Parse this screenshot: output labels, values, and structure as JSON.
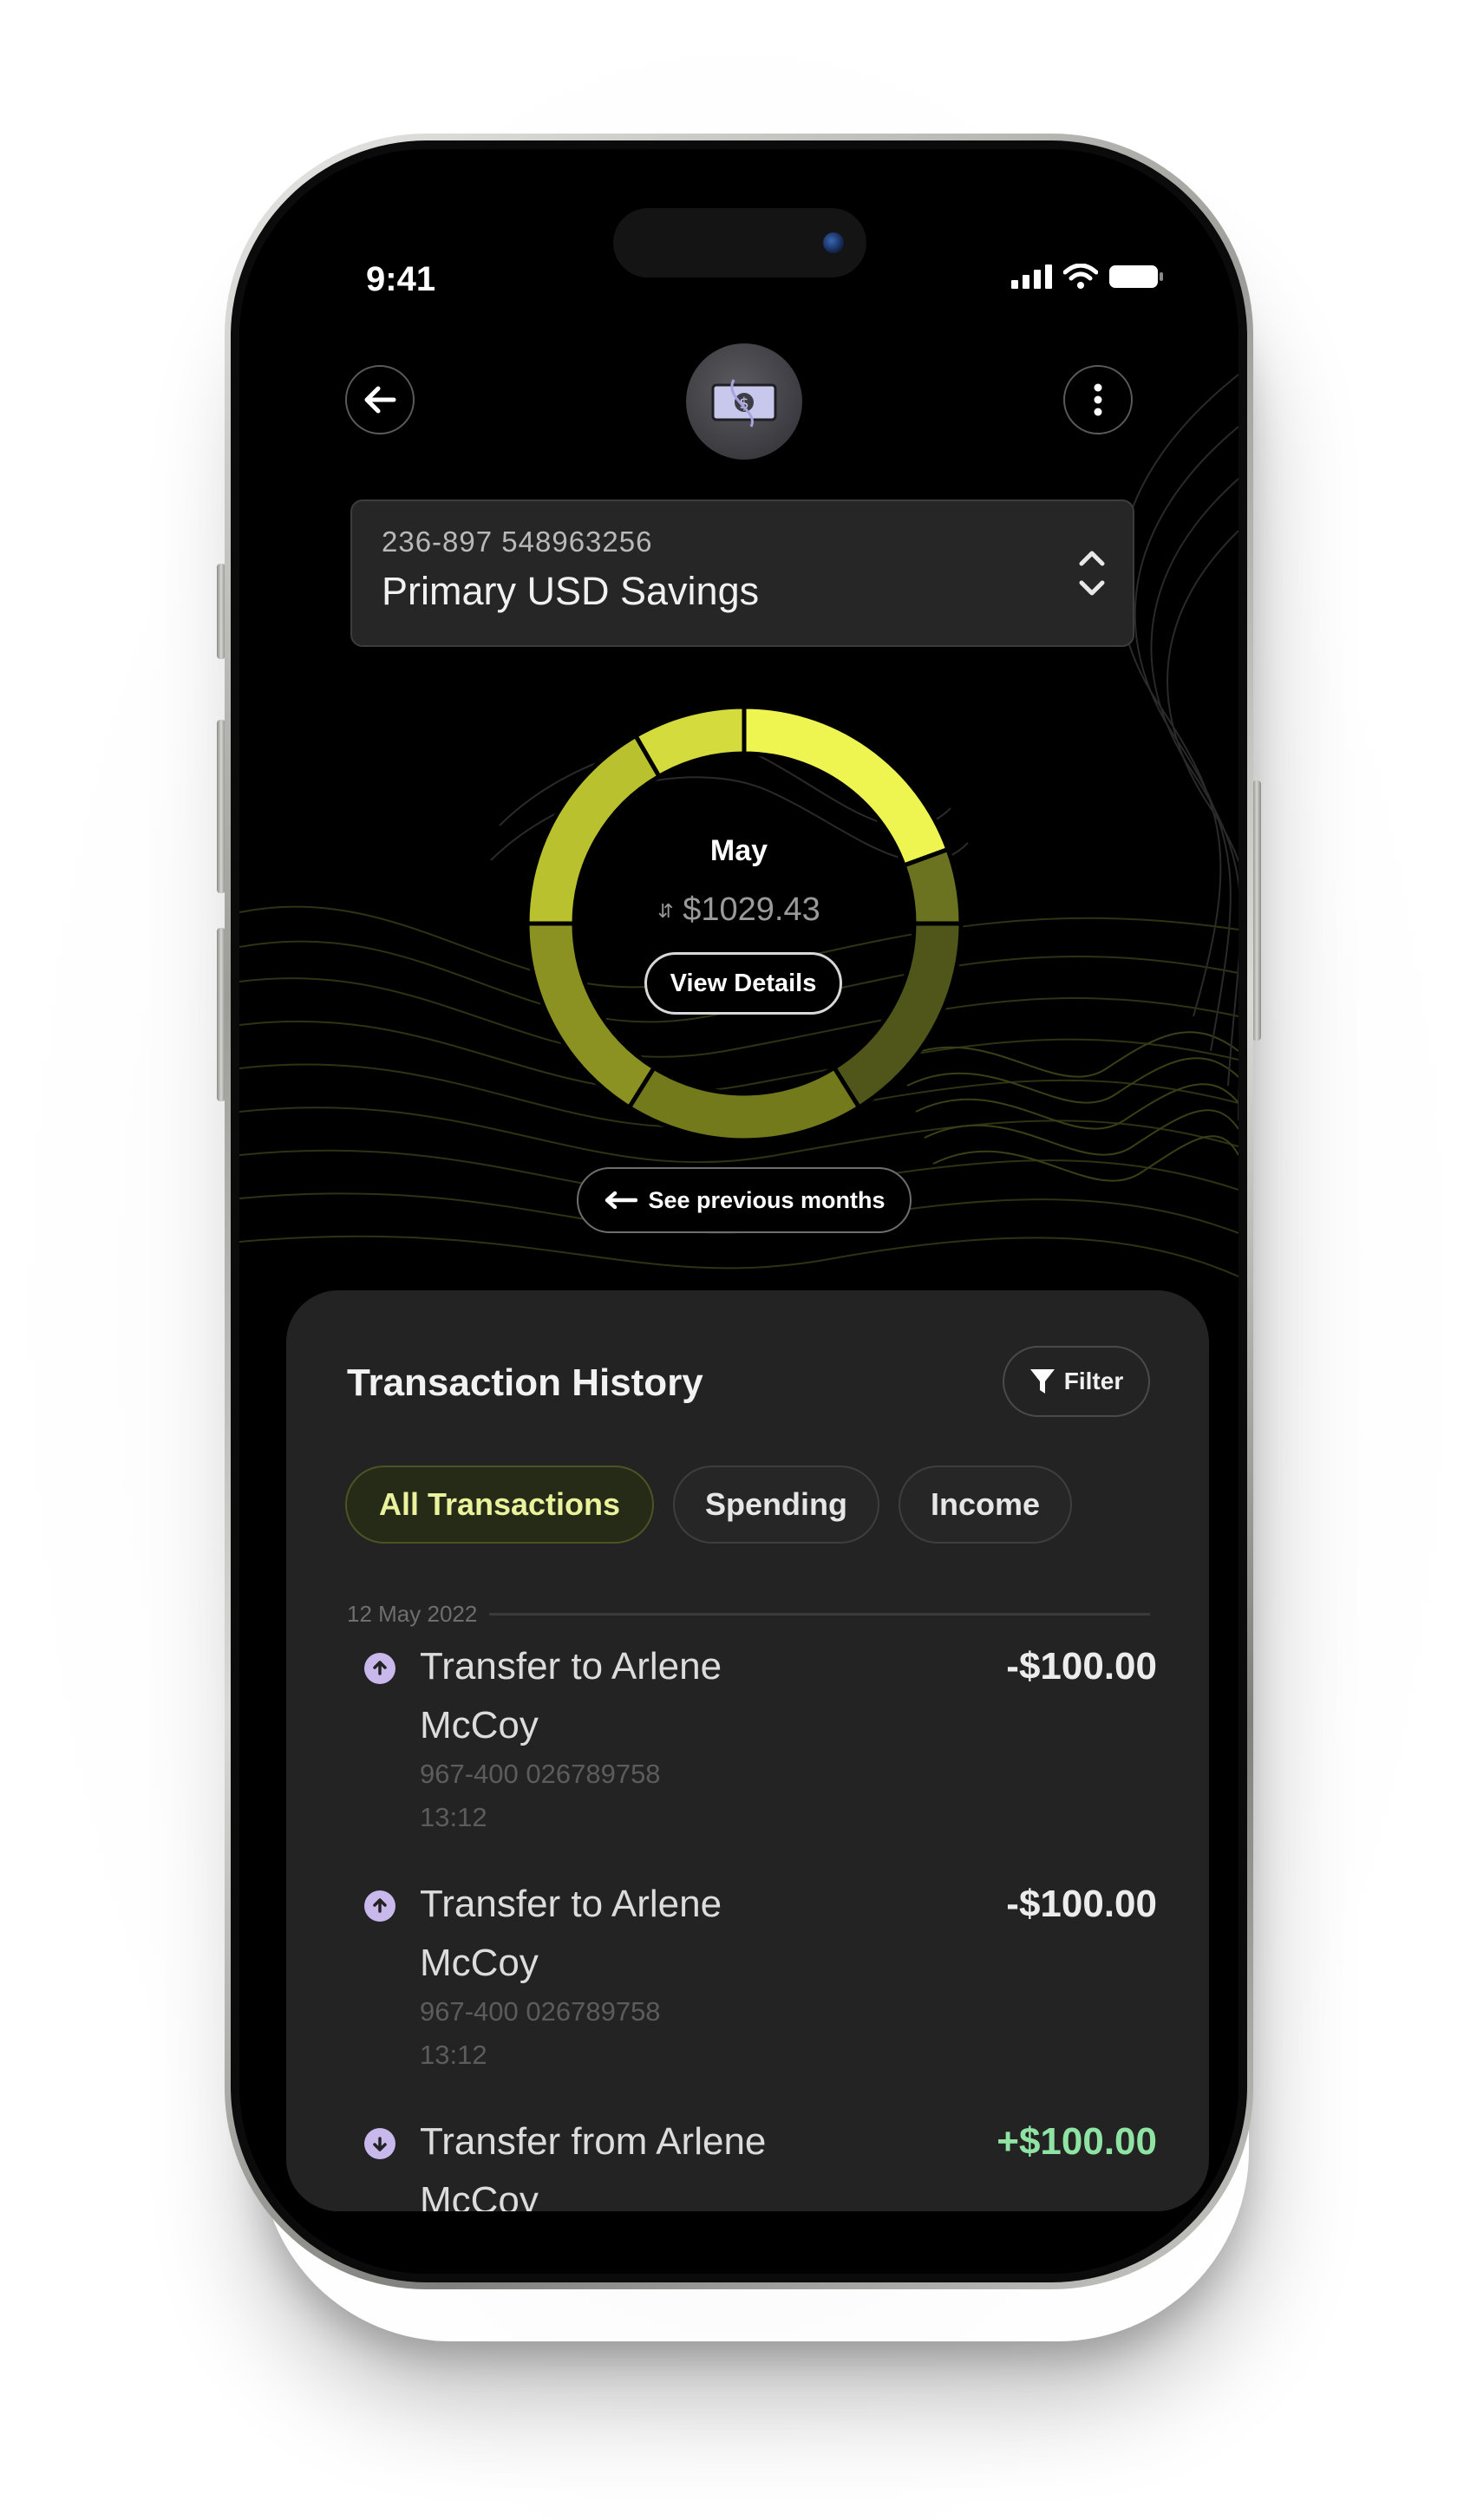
{
  "status_bar": {
    "time": "9:41"
  },
  "header": {
    "back_icon": "arrow-left-icon",
    "avatar_icon": "money-bill-icon",
    "more_icon": "vertical-dots-icon"
  },
  "account": {
    "number": "236-897 548963256",
    "name": "Primary USD Savings",
    "selector_icon": "chevron-up-down-icon"
  },
  "summary": {
    "month": "May",
    "amount": "$1029.43",
    "view_details_label": "View Details",
    "previous_months_label": "See previous months",
    "segment_colors": [
      "#eef551",
      "#d4db3c",
      "#b9c22e",
      "#8b9222",
      "#727a1b",
      "#50551a",
      "#6b7320"
    ]
  },
  "history": {
    "title": "Transaction History",
    "filter_label": "Filter",
    "tabs": [
      {
        "label": "All Transactions",
        "active": true
      },
      {
        "label": "Spending",
        "active": false
      },
      {
        "label": "Income",
        "active": false
      }
    ],
    "date_group": "12 May 2022",
    "transactions": [
      {
        "title": "Transfer to Arlene McCoy",
        "account": "967-400 026789758",
        "time": "13:12",
        "amount": "-$100.00",
        "direction": "out"
      },
      {
        "title": "Transfer to Arlene McCoy",
        "account": "967-400 026789758",
        "time": "13:12",
        "amount": "-$100.00",
        "direction": "out"
      },
      {
        "title": "Transfer from Arlene McCoy",
        "account": "",
        "time": "",
        "amount": "+$100.00",
        "direction": "in"
      }
    ]
  },
  "colors": {
    "accent": "#eef551",
    "income": "#8fe3a3",
    "background": "#000000",
    "card": "#232323",
    "icon_badge": "#c9b8ec"
  }
}
